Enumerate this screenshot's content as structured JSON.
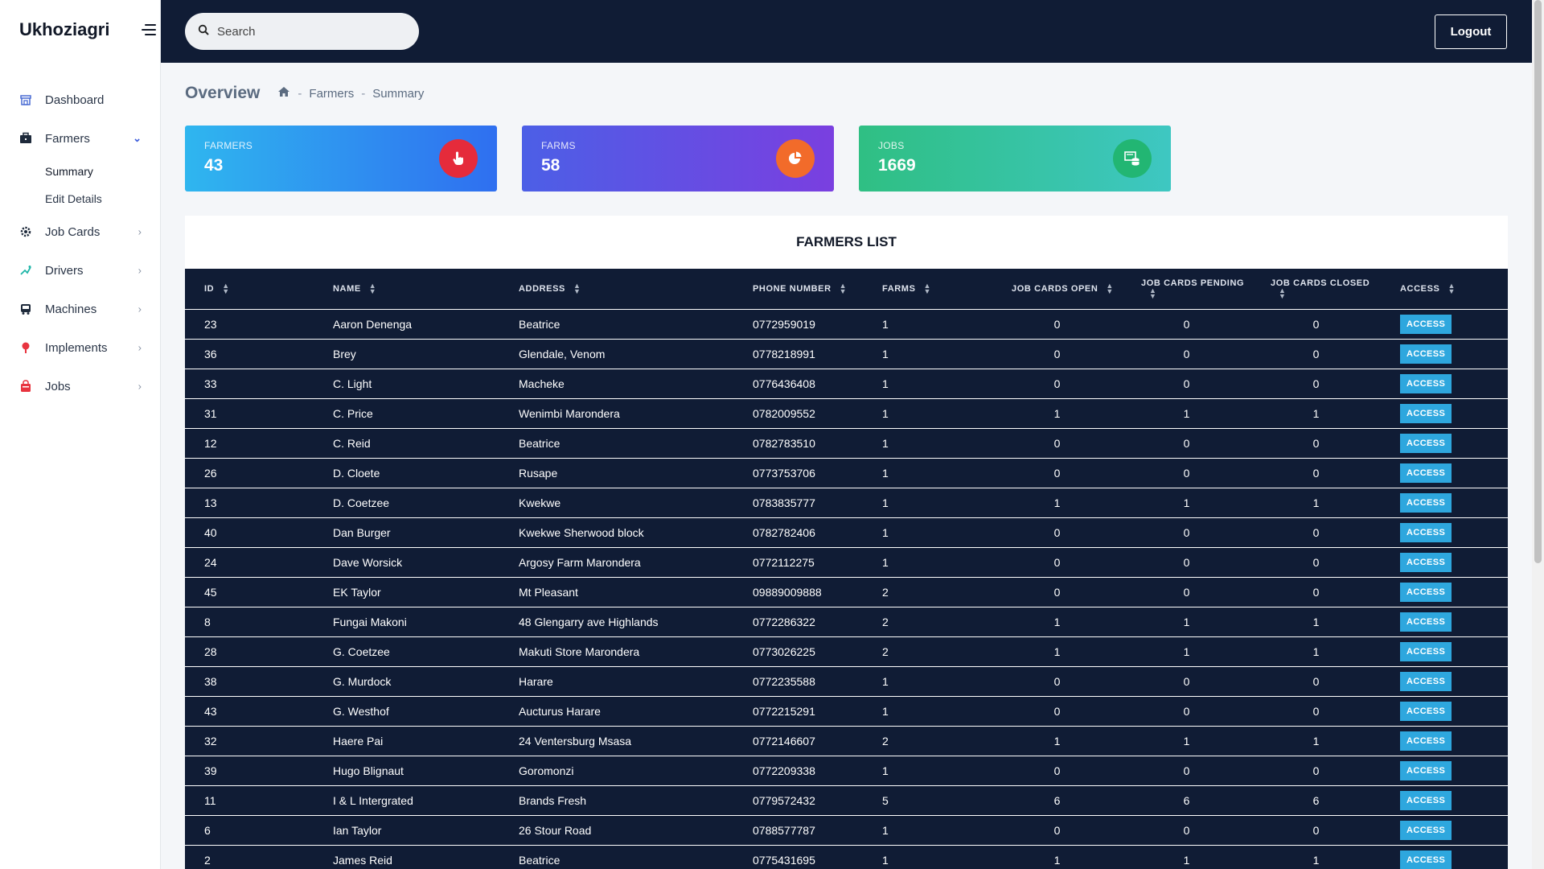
{
  "app": {
    "brand": "Ukhoziagri"
  },
  "sidebar": {
    "items": [
      {
        "label": "Dashboard",
        "icon": "dashboard-icon"
      },
      {
        "label": "Farmers",
        "icon": "briefcase-icon",
        "expanded": true,
        "children": [
          {
            "label": "Summary"
          },
          {
            "label": "Edit Details"
          }
        ]
      },
      {
        "label": "Job Cards",
        "icon": "gear-icon"
      },
      {
        "label": "Drivers",
        "icon": "steering-icon"
      },
      {
        "label": "Machines",
        "icon": "truck-icon"
      },
      {
        "label": "Implements",
        "icon": "pin-icon"
      },
      {
        "label": "Jobs",
        "icon": "bag-icon"
      }
    ]
  },
  "topbar": {
    "search_placeholder": "Search",
    "logout_label": "Logout"
  },
  "header": {
    "title": "Overview",
    "breadcrumb": [
      "Farmers",
      "Summary"
    ]
  },
  "stats": [
    {
      "label": "FARMERS",
      "value": "43",
      "icon": "hand-pointer-icon",
      "badge_color": "#e52b3b"
    },
    {
      "label": "FARMS",
      "value": "58",
      "icon": "pie-chart-icon",
      "badge_color": "#f26b2a"
    },
    {
      "label": "JOBS",
      "value": "1669",
      "icon": "database-icon",
      "badge_color": "#22b673"
    }
  ],
  "table": {
    "title": "FARMERS LIST",
    "columns": [
      "ID",
      "NAME",
      "ADDRESS",
      "PHONE NUMBER",
      "FARMS",
      "JOB CARDS OPEN",
      "JOB CARDS PENDING",
      "JOB CARDS CLOSED",
      "ACCESS"
    ],
    "access_label": "ACCESS",
    "rows": [
      [
        "23",
        "Aaron Denenga",
        "Beatrice",
        "0772959019",
        "1",
        "0",
        "0",
        "0"
      ],
      [
        "36",
        "Brey",
        "Glendale, Venom",
        "0778218991",
        "1",
        "0",
        "0",
        "0"
      ],
      [
        "33",
        "C. Light",
        "Macheke",
        "0776436408",
        "1",
        "0",
        "0",
        "0"
      ],
      [
        "31",
        "C. Price",
        "Wenimbi Marondera",
        "0782009552",
        "1",
        "1",
        "1",
        "1"
      ],
      [
        "12",
        "C. Reid",
        "Beatrice",
        "0782783510",
        "1",
        "0",
        "0",
        "0"
      ],
      [
        "26",
        "D. Cloete",
        "Rusape",
        "0773753706",
        "1",
        "0",
        "0",
        "0"
      ],
      [
        "13",
        "D. Coetzee",
        "Kwekwe",
        "0783835777",
        "1",
        "1",
        "1",
        "1"
      ],
      [
        "40",
        "Dan Burger",
        "Kwekwe Sherwood block",
        "0782782406",
        "1",
        "0",
        "0",
        "0"
      ],
      [
        "24",
        "Dave Worsick",
        "Argosy Farm Marondera",
        "0772112275",
        "1",
        "0",
        "0",
        "0"
      ],
      [
        "45",
        "EK Taylor",
        "Mt Pleasant",
        "09889009888",
        "2",
        "0",
        "0",
        "0"
      ],
      [
        "8",
        "Fungai Makoni",
        "48 Glengarry ave Highlands",
        "0772286322",
        "2",
        "1",
        "1",
        "1"
      ],
      [
        "28",
        "G. Coetzee",
        "Makuti Store Marondera",
        "0773026225",
        "2",
        "1",
        "1",
        "1"
      ],
      [
        "38",
        "G. Murdock",
        "Harare",
        "0772235588",
        "1",
        "0",
        "0",
        "0"
      ],
      [
        "43",
        "G. Westhof",
        "Aucturus Harare",
        "0772215291",
        "1",
        "0",
        "0",
        "0"
      ],
      [
        "32",
        "Haere Pai",
        "24 Ventersburg Msasa",
        "0772146607",
        "2",
        "1",
        "1",
        "1"
      ],
      [
        "39",
        "Hugo Blignaut",
        "Goromonzi",
        "0772209338",
        "1",
        "0",
        "0",
        "0"
      ],
      [
        "11",
        "I & L Intergrated",
        "Brands Fresh",
        "0779572432",
        "5",
        "6",
        "6",
        "6"
      ],
      [
        "6",
        "Ian Taylor",
        "26 Stour Road",
        "0788577787",
        "1",
        "0",
        "0",
        "0"
      ],
      [
        "2",
        "James Reid",
        "Beatrice",
        "0775431695",
        "1",
        "1",
        "1",
        "1"
      ]
    ]
  }
}
